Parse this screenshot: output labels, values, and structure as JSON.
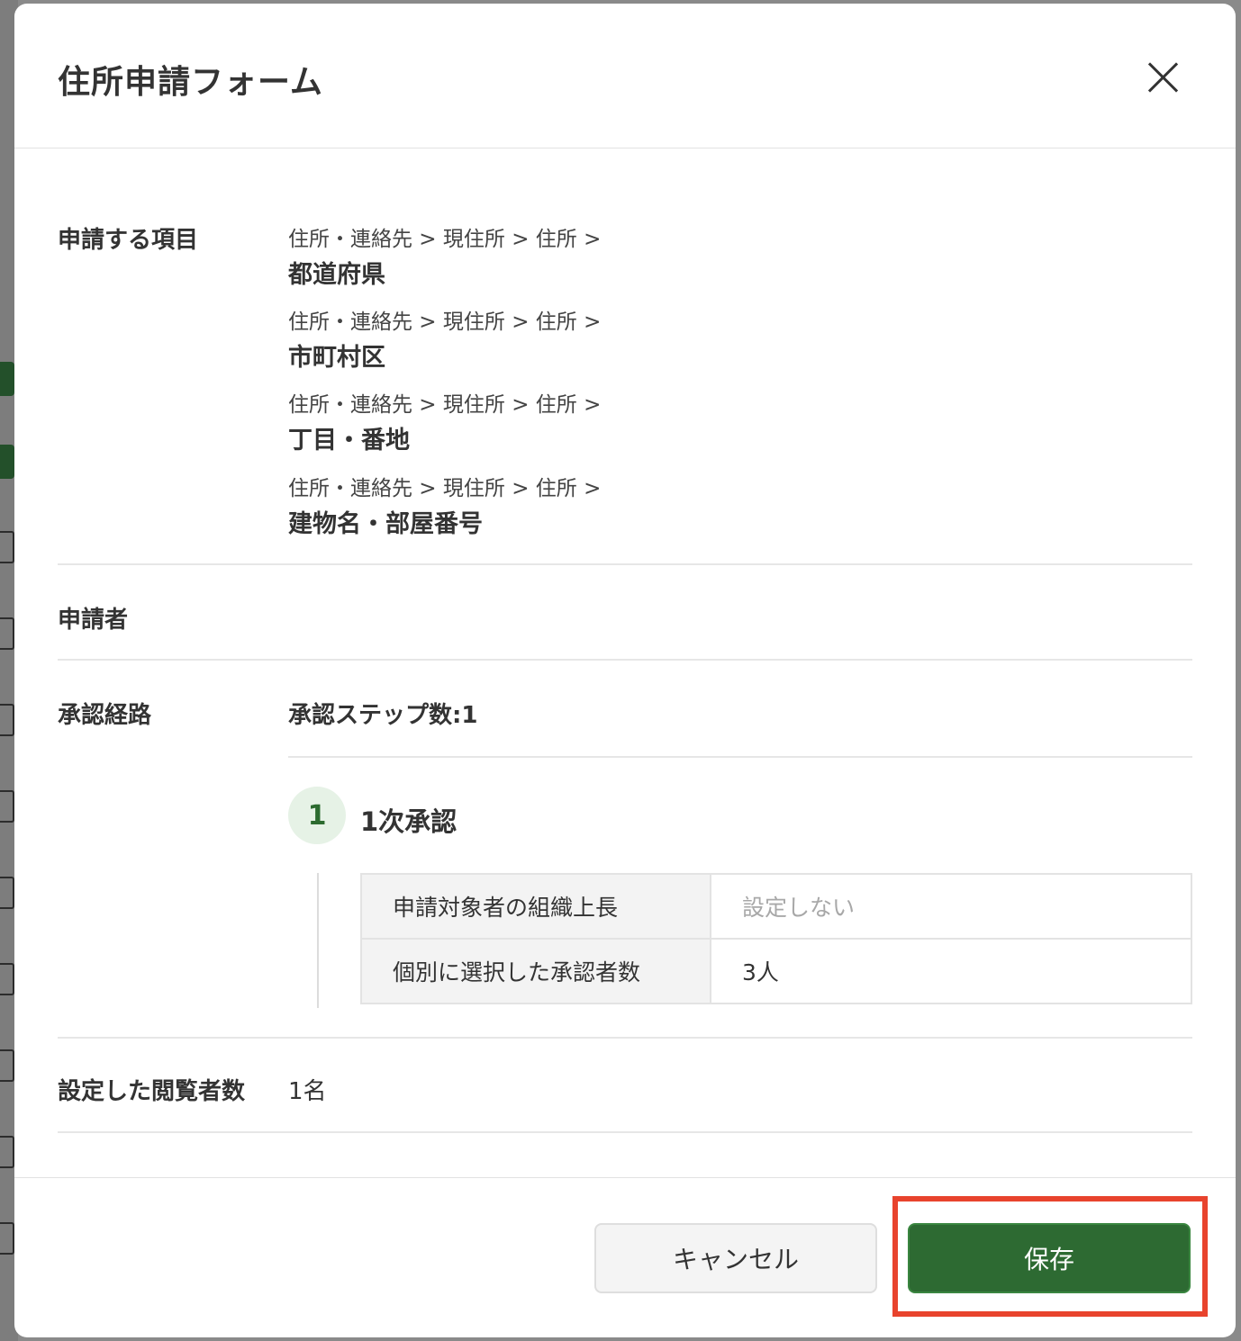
{
  "modal": {
    "title": "住所申請フォーム",
    "close_label": "×"
  },
  "sections": {
    "items": {
      "label": "申請する項目",
      "entries": [
        {
          "path": "住所・連絡先 > 現住所 > 住所 >",
          "name": "都道府県"
        },
        {
          "path": "住所・連絡先 > 現住所 > 住所 >",
          "name": "市町村区"
        },
        {
          "path": "住所・連絡先 > 現住所 > 住所 >",
          "name": "丁目・番地"
        },
        {
          "path": "住所・連絡先 > 現住所 > 住所 >",
          "name": "建物名・部屋番号"
        }
      ]
    },
    "applicant": {
      "label": "申請者"
    },
    "route": {
      "label": "承認経路",
      "step_count": "承認ステップ数:1",
      "step": {
        "number": "1",
        "title": "1次承認",
        "rows": [
          {
            "key": "申請対象者の組織上長",
            "value": "設定しない"
          },
          {
            "key": "個別に選択した承認者数",
            "value": "3人"
          }
        ]
      }
    },
    "viewers": {
      "label": "設定した閲覧者数",
      "value": "1名"
    }
  },
  "footer": {
    "cancel_label": "キャンセル",
    "save_label": "保存"
  },
  "colors": {
    "primary": "#2d6a32",
    "highlight": "#e8432d",
    "step_bg": "#e6f2e6"
  }
}
